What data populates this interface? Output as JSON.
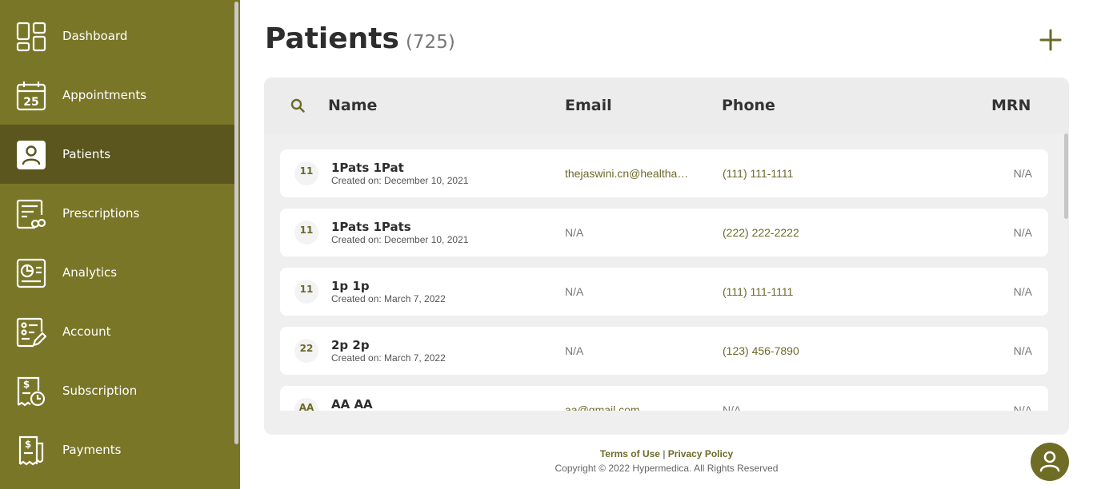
{
  "sidebar": {
    "items": [
      {
        "label": "Dashboard",
        "icon": "dashboard-icon"
      },
      {
        "label": "Appointments",
        "icon": "calendar-icon",
        "icon_text": "25"
      },
      {
        "label": "Patients",
        "icon": "patient-icon",
        "active": true
      },
      {
        "label": "Prescriptions",
        "icon": "prescription-icon"
      },
      {
        "label": "Analytics",
        "icon": "analytics-icon"
      },
      {
        "label": "Account",
        "icon": "account-icon"
      },
      {
        "label": "Subscription",
        "icon": "subscription-icon"
      },
      {
        "label": "Payments",
        "icon": "payments-icon"
      }
    ]
  },
  "page": {
    "title": "Patients",
    "count": "(725)"
  },
  "table": {
    "headers": {
      "name": "Name",
      "email": "Email",
      "phone": "Phone",
      "mrn": "MRN"
    },
    "rows": [
      {
        "initials": "11",
        "name": "1Pats 1Pat",
        "created": "Created on: December 10, 2021",
        "email": "thejaswini.cn@healthassure.in",
        "phone": "(111) 111-1111",
        "mrn": "N/A"
      },
      {
        "initials": "11",
        "name": "1Pats 1Pats",
        "created": "Created on: December 10, 2021",
        "email": "N/A",
        "phone": "(222) 222-2222",
        "mrn": "N/A"
      },
      {
        "initials": "11",
        "name": "1p 1p",
        "created": "Created on: March 7, 2022",
        "email": "N/A",
        "phone": "(111) 111-1111",
        "mrn": "N/A"
      },
      {
        "initials": "22",
        "name": "2p 2p",
        "created": "Created on: March 7, 2022",
        "email": "N/A",
        "phone": "(123) 456-7890",
        "mrn": "N/A"
      },
      {
        "initials": "AA",
        "name": "AA AA",
        "created": "",
        "email": "aa@gmail.com",
        "phone": "N/A",
        "mrn": "N/A"
      }
    ]
  },
  "footer": {
    "terms": "Terms of Use",
    "separator": "|",
    "privacy": "Privacy Policy",
    "copyright": "Copyright © 2022 Hypermedica. All Rights Reserved"
  },
  "colors": {
    "sidebar": "#7a7628",
    "sidebar_active": "#5a561d",
    "accent": "#6d6a2a"
  }
}
